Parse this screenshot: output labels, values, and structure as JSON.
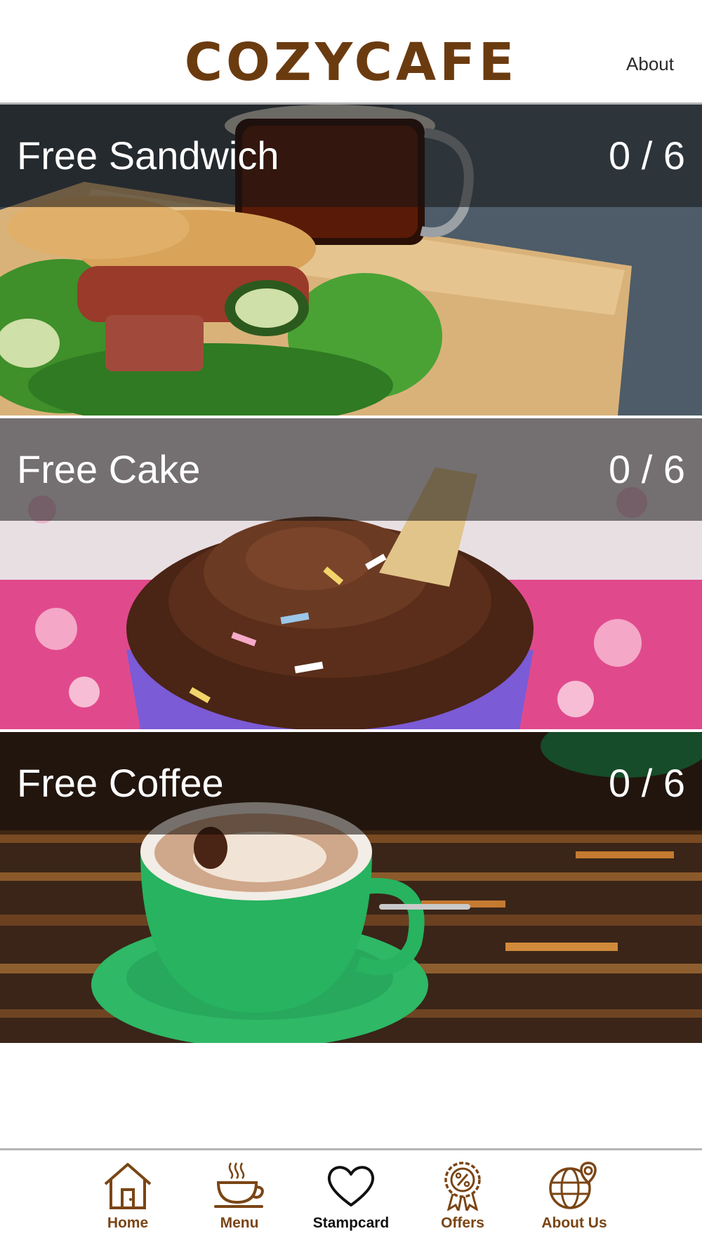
{
  "header": {
    "logo": "COZYCAFE",
    "about_link": "About"
  },
  "rewards": [
    {
      "title": "Free Sandwich",
      "count": "0 / 6",
      "stamps": 0,
      "total": 6
    },
    {
      "title": "Free Cake",
      "count": "0 / 6",
      "stamps": 0,
      "total": 6
    },
    {
      "title": "Free Coffee",
      "count": "0 / 6",
      "stamps": 0,
      "total": 6
    }
  ],
  "nav": {
    "active": "Stampcard",
    "items": [
      {
        "label": "Home",
        "icon": "home-icon"
      },
      {
        "label": "Menu",
        "icon": "coffee-cup-icon"
      },
      {
        "label": "Stampcard",
        "icon": "heart-icon"
      },
      {
        "label": "Offers",
        "icon": "percent-badge-icon"
      },
      {
        "label": "About Us",
        "icon": "globe-pin-icon"
      }
    ]
  },
  "colors": {
    "brand": "#6b3b10",
    "nav_label": "#7a4515",
    "active_label": "#111111"
  }
}
